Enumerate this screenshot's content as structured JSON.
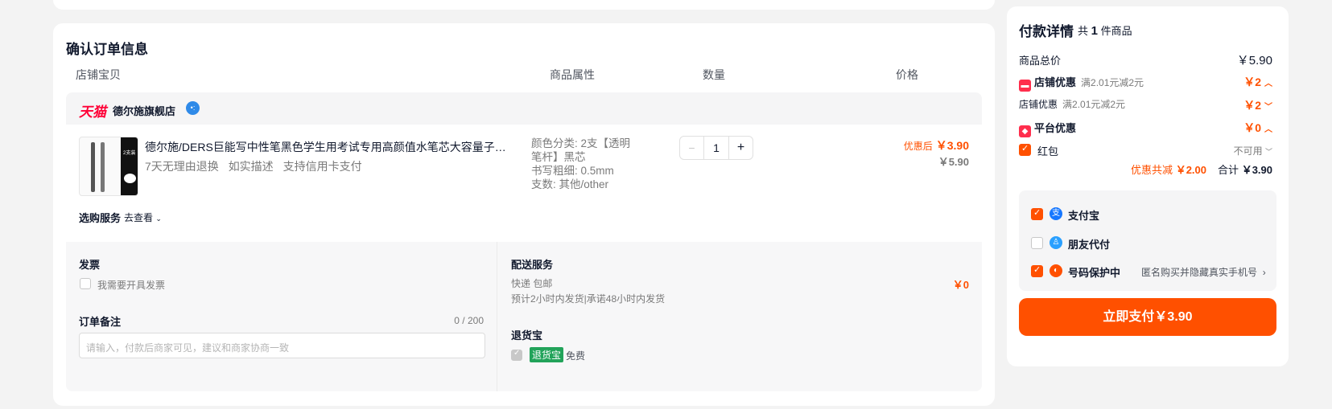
{
  "order": {
    "title": "确认订单信息",
    "columns": {
      "item": "店铺宝贝",
      "attrs": "商品属性",
      "qty": "数量",
      "price": "价格"
    },
    "shop": {
      "platform_logo": "天猫",
      "name": "德尔施旗舰店"
    },
    "item": {
      "title": "德尔施/DERS巨能写中性笔黑色学生用考试专用高颜值水笔芯大容量子弹头…",
      "tags": [
        "7天无理由退换",
        "如实描述",
        "支持信用卡支付"
      ],
      "attrs": [
        "颜色分类: 2支【透明",
        "笔杆】黑芯",
        "书写粗细: 0.5mm",
        "支数: 其他/other"
      ],
      "quantity": "1",
      "price_after_label": "优惠后",
      "price_after": "￥3.90",
      "price_original": "￥5.90"
    },
    "service": {
      "label": "选购服务",
      "link": "去查看"
    },
    "invoice": {
      "title": "发票",
      "checkbox_label": "我需要开具发票"
    },
    "memo": {
      "title": "订单备注",
      "counter": "0 / 200",
      "placeholder": "请输入，付款后商家可见，建议和商家协商一致"
    },
    "delivery": {
      "title": "配送服务",
      "method": "快递 包邮",
      "note": "预计2小时内发货|承诺48小时内发货",
      "price": "￥0"
    },
    "tuihuobao": {
      "title": "退货宝",
      "badge": "退货宝",
      "text": "免费"
    }
  },
  "payment": {
    "title": "付款详情",
    "count_prefix": "共",
    "count": "1",
    "count_suffix": "件商品",
    "total_label": "商品总价",
    "total_value": "￥5.90",
    "shop_discount_label": "店铺优惠",
    "shop_discount_desc": "满2.01元减2元",
    "shop_discount_value": "￥2",
    "shop_discount_sub_label": "店铺优惠",
    "shop_discount_sub_desc": "满2.01元减2元",
    "shop_discount_sub_value": "￥2",
    "platform_discount_label": "平台优惠",
    "platform_discount_value": "￥0",
    "red_packet_label": "红包",
    "red_packet_status": "不可用",
    "saved_label": "优惠共减",
    "saved_value": "￥2.00",
    "sum_label": "合计",
    "sum_value": "￥3.90",
    "methods": [
      {
        "label": "支付宝",
        "checked": true
      },
      {
        "label": "朋友代付",
        "checked": false
      },
      {
        "label": "号码保护中",
        "checked": true,
        "note": "匿名购买并隐藏真实手机号"
      }
    ],
    "pay_button": "立即支付￥3.90"
  },
  "colors": {
    "accent": "#ff5000",
    "tmall": "#ff0036",
    "alipay": "#1677ff",
    "tuihuobao": "#22a35a"
  }
}
